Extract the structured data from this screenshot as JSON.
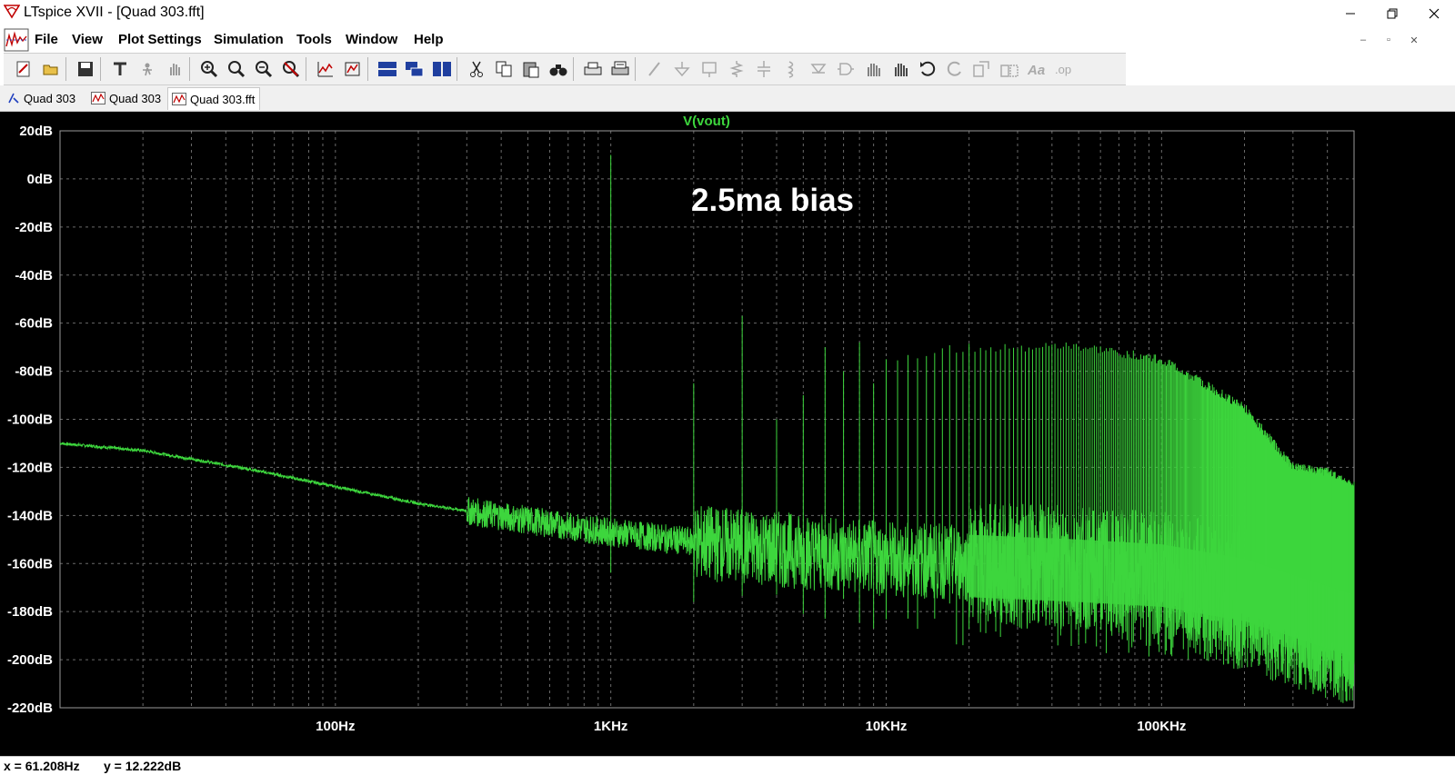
{
  "window": {
    "title": "LTspice XVII - [Quad 303.fft]",
    "controls": [
      "minimize-icon",
      "maximize-icon",
      "close-icon"
    ]
  },
  "menu": {
    "items": [
      {
        "label": "File"
      },
      {
        "label": "View"
      },
      {
        "label": "Plot Settings"
      },
      {
        "label": "Simulation"
      },
      {
        "label": "Tools"
      },
      {
        "label": "Window"
      },
      {
        "label": "Help"
      }
    ]
  },
  "toolbar": {
    "icons": [
      "new-schematic-icon",
      "open-icon",
      "save-icon",
      "control-panel-icon",
      "run-icon",
      "halt-icon",
      "zoom-in-icon",
      "zoom-box-icon",
      "zoom-out-icon",
      "zoom-cancel-icon",
      "autorange-icon",
      "pick-visible-icon",
      "tile-horizontal-icon",
      "cascade-icon",
      "tile-vertical-icon",
      "cut-icon",
      "copy-icon",
      "paste-icon",
      "find-icon",
      "print-icon",
      "print-preview-icon",
      "wire-icon",
      "ground-icon",
      "label-icon",
      "resistor-icon",
      "capacitor-icon",
      "inductor-icon",
      "diode-icon",
      "component-icon",
      "move-icon",
      "drag-icon",
      "undo-icon",
      "redo-icon",
      "rotate-icon",
      "mirror-icon",
      "text-icon",
      "spice-directive-icon"
    ]
  },
  "tabs": [
    {
      "label": "Quad 303",
      "icon": "schematic-icon"
    },
    {
      "label": "Quad 303",
      "icon": "waveform-icon"
    },
    {
      "label": "Quad 303.fft",
      "icon": "waveform-icon",
      "active": true
    }
  ],
  "plot": {
    "trace_label": "V(vout)",
    "annotation": "2.5ma bias",
    "background": "#000000",
    "grid_color": "#6a6a6a",
    "trace_color": "#3dd63d",
    "axis_text_color": "#ffffff"
  },
  "chart_data": {
    "type": "line",
    "title": "V(vout)",
    "xlabel": "",
    "ylabel": "",
    "x_scale": "log",
    "xlim": [
      10,
      500000
    ],
    "ylim": [
      -220,
      20
    ],
    "grid": true,
    "y_ticks": [
      "20dB",
      "0dB",
      "-20dB",
      "-40dB",
      "-60dB",
      "-80dB",
      "-100dB",
      "-120dB",
      "-140dB",
      "-160dB",
      "-180dB",
      "-200dB",
      "-220dB"
    ],
    "x_ticks": [
      "100Hz",
      "1KHz",
      "10KHz",
      "100KHz"
    ],
    "annotation": "2.5ma bias",
    "series": [
      {
        "name": "V(vout)",
        "color": "#3dd63d",
        "noise_floor": {
          "x": [
            10,
            20,
            50,
            100,
            200,
            500,
            1000,
            2000,
            5000,
            10000,
            20000,
            50000,
            100000,
            200000,
            500000
          ],
          "y": [
            -110,
            -113,
            -121,
            -128,
            -135,
            -142,
            -147,
            -151,
            -155,
            -158,
            -160,
            -162,
            -164,
            -170,
            -185
          ]
        },
        "harmonics": {
          "fundamental_hz": 1000,
          "x": [
            1000,
            2000,
            3000,
            4000,
            5000,
            6000,
            7000,
            8000,
            9000,
            10000,
            20000,
            50000,
            100000,
            200000,
            300000,
            400000,
            500000
          ],
          "y": [
            10,
            -85,
            -57,
            -100,
            -90,
            -70,
            -80,
            -68,
            -85,
            -75,
            -70,
            -70,
            -75,
            -95,
            -120,
            -122,
            -128
          ]
        }
      }
    ]
  },
  "status": {
    "x_readout": "x = 61.208Hz",
    "y_readout": "y = 12.222dB"
  }
}
